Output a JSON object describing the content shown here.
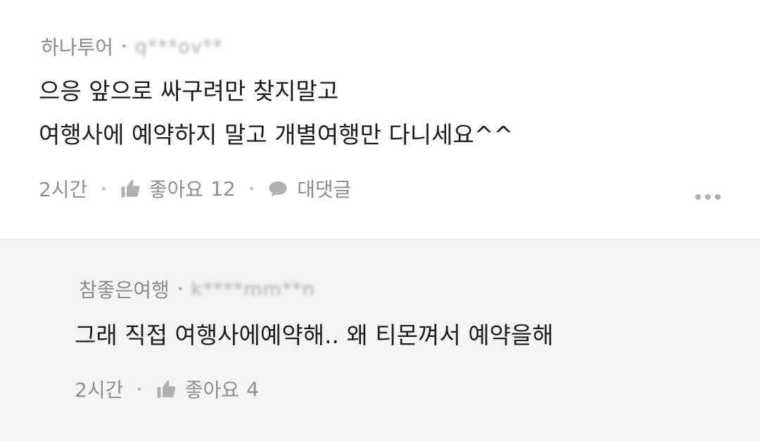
{
  "comment": {
    "author": "하나투어",
    "masked_id": "q***ov**",
    "lines": [
      "으응 앞으로 싸구려만 찾지말고",
      "여행사에 예약하지 말고 개별여행만 다니세요^^"
    ],
    "time": "2시간",
    "like_label": "좋아요",
    "like_count": "12",
    "reply_label": "대댓글"
  },
  "reply": {
    "author": "참좋은여행",
    "masked_id": "k****mm**n",
    "text": "그래 직접 여행사에예약해.. 왜 티몬껴서 예약을해",
    "time": "2시간",
    "like_label": "좋아요",
    "like_count": "4"
  },
  "icons": {
    "like": "thumbs-up-icon",
    "reply": "speech-bubble-icon",
    "more": "more-dots-icon"
  },
  "colors": {
    "meta_text": "#8e8e8e",
    "icon": "#b0b0b0",
    "reply_bg": "#f4f4f4"
  }
}
